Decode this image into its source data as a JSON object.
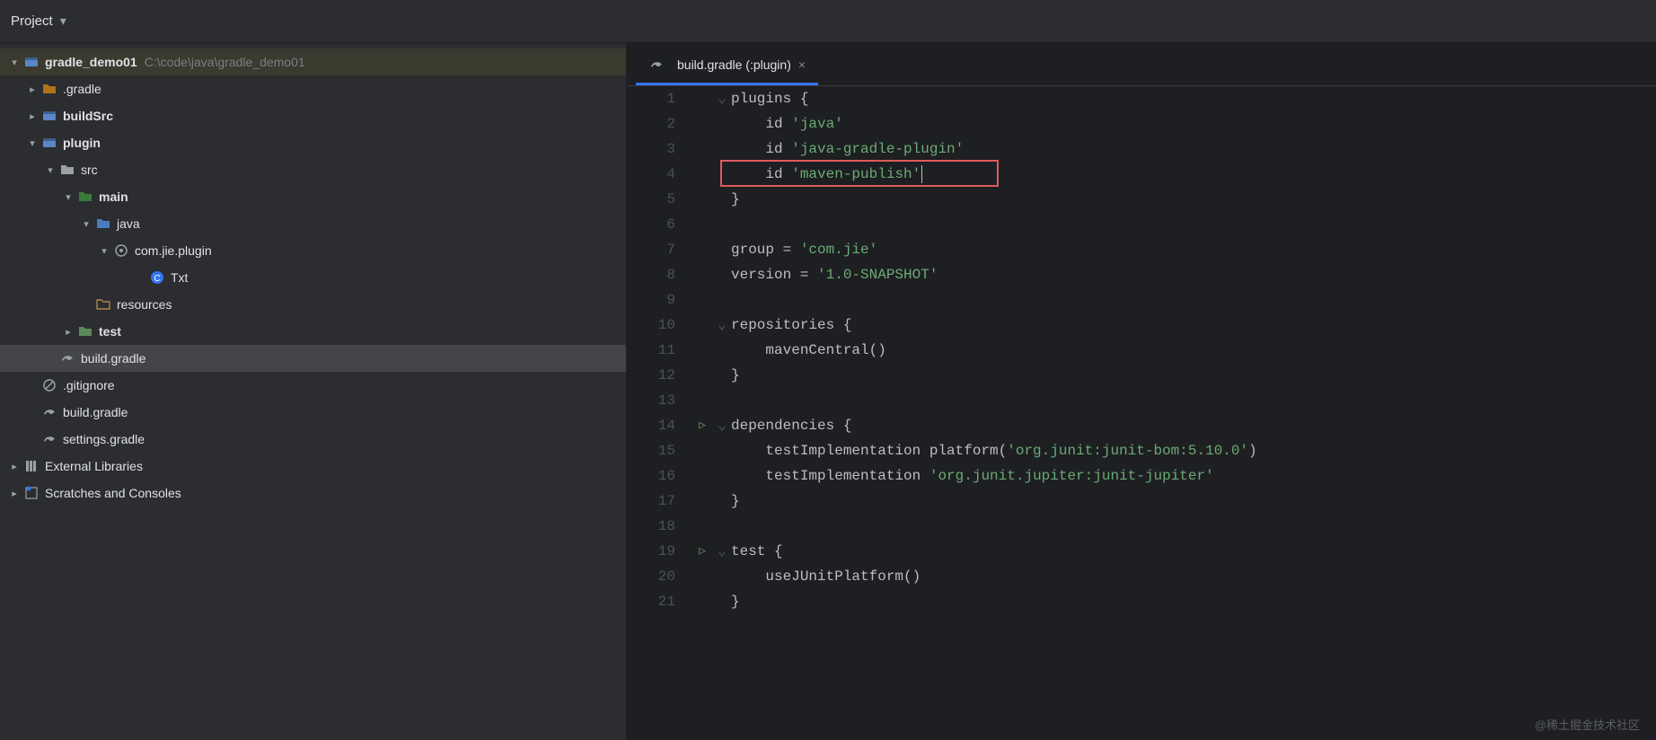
{
  "titleBar": {
    "label": "Project"
  },
  "tree": {
    "root": {
      "name": "gradle_demo01",
      "path": "C:\\code\\java\\gradle_demo01"
    },
    "gradleDir": ".gradle",
    "buildSrc": "buildSrc",
    "pluginMod": "plugin",
    "src": "src",
    "main": "main",
    "javaDir": "java",
    "pkg": "com.jie.plugin",
    "classTxt": "Txt",
    "resources": "resources",
    "test": "test",
    "pluginBuild": "build.gradle",
    "gitignore": ".gitignore",
    "rootBuild": "build.gradle",
    "settings": "settings.gradle",
    "extLibs": "External Libraries",
    "scratches": "Scratches and Consoles"
  },
  "tab": {
    "label": "build.gradle (:plugin)"
  },
  "code": {
    "lines": [
      {
        "n": 1,
        "fold": "v",
        "t": [
          [
            "",
            "plugins {"
          ]
        ]
      },
      {
        "n": 2,
        "t": [
          [
            "",
            "    id "
          ],
          [
            "str",
            "'java'"
          ]
        ]
      },
      {
        "n": 3,
        "t": [
          [
            "",
            "    id "
          ],
          [
            "str",
            "'java-gradle-plugin'"
          ]
        ]
      },
      {
        "n": 4,
        "t": [
          [
            "",
            "    id "
          ],
          [
            "str",
            "'maven-publish'"
          ]
        ],
        "highlighted": true,
        "cursor": true
      },
      {
        "n": 5,
        "t": [
          [
            "",
            "}"
          ]
        ]
      },
      {
        "n": 6,
        "t": [
          [
            "",
            ""
          ]
        ]
      },
      {
        "n": 7,
        "t": [
          [
            "",
            "group = "
          ],
          [
            "str",
            "'com.jie'"
          ]
        ]
      },
      {
        "n": 8,
        "t": [
          [
            "",
            "version = "
          ],
          [
            "str",
            "'1.0-SNAPSHOT'"
          ]
        ]
      },
      {
        "n": 9,
        "t": [
          [
            "",
            ""
          ]
        ]
      },
      {
        "n": 10,
        "fold": "v",
        "t": [
          [
            "",
            "repositories {"
          ]
        ]
      },
      {
        "n": 11,
        "t": [
          [
            "",
            "    mavenCentral()"
          ]
        ]
      },
      {
        "n": 12,
        "t": [
          [
            "",
            "}"
          ]
        ]
      },
      {
        "n": 13,
        "t": [
          [
            "",
            ""
          ]
        ]
      },
      {
        "n": 14,
        "run": true,
        "fold": "v",
        "t": [
          [
            "",
            "dependencies {"
          ]
        ]
      },
      {
        "n": 15,
        "t": [
          [
            "",
            "    testImplementation platform("
          ],
          [
            "str",
            "'org.junit:junit-bom:5.10.0'"
          ],
          [
            "",
            ")"
          ]
        ]
      },
      {
        "n": 16,
        "t": [
          [
            "",
            "    testImplementation "
          ],
          [
            "str",
            "'org.junit.jupiter:junit-jupiter'"
          ]
        ]
      },
      {
        "n": 17,
        "t": [
          [
            "",
            "}"
          ]
        ]
      },
      {
        "n": 18,
        "t": [
          [
            "",
            ""
          ]
        ]
      },
      {
        "n": 19,
        "run": true,
        "fold": "v",
        "t": [
          [
            "",
            "test {"
          ]
        ]
      },
      {
        "n": 20,
        "t": [
          [
            "",
            "    useJUnitPlatform()"
          ]
        ]
      },
      {
        "n": 21,
        "t": [
          [
            "",
            "}"
          ]
        ]
      }
    ]
  },
  "watermark": "@稀土掘金技术社区"
}
